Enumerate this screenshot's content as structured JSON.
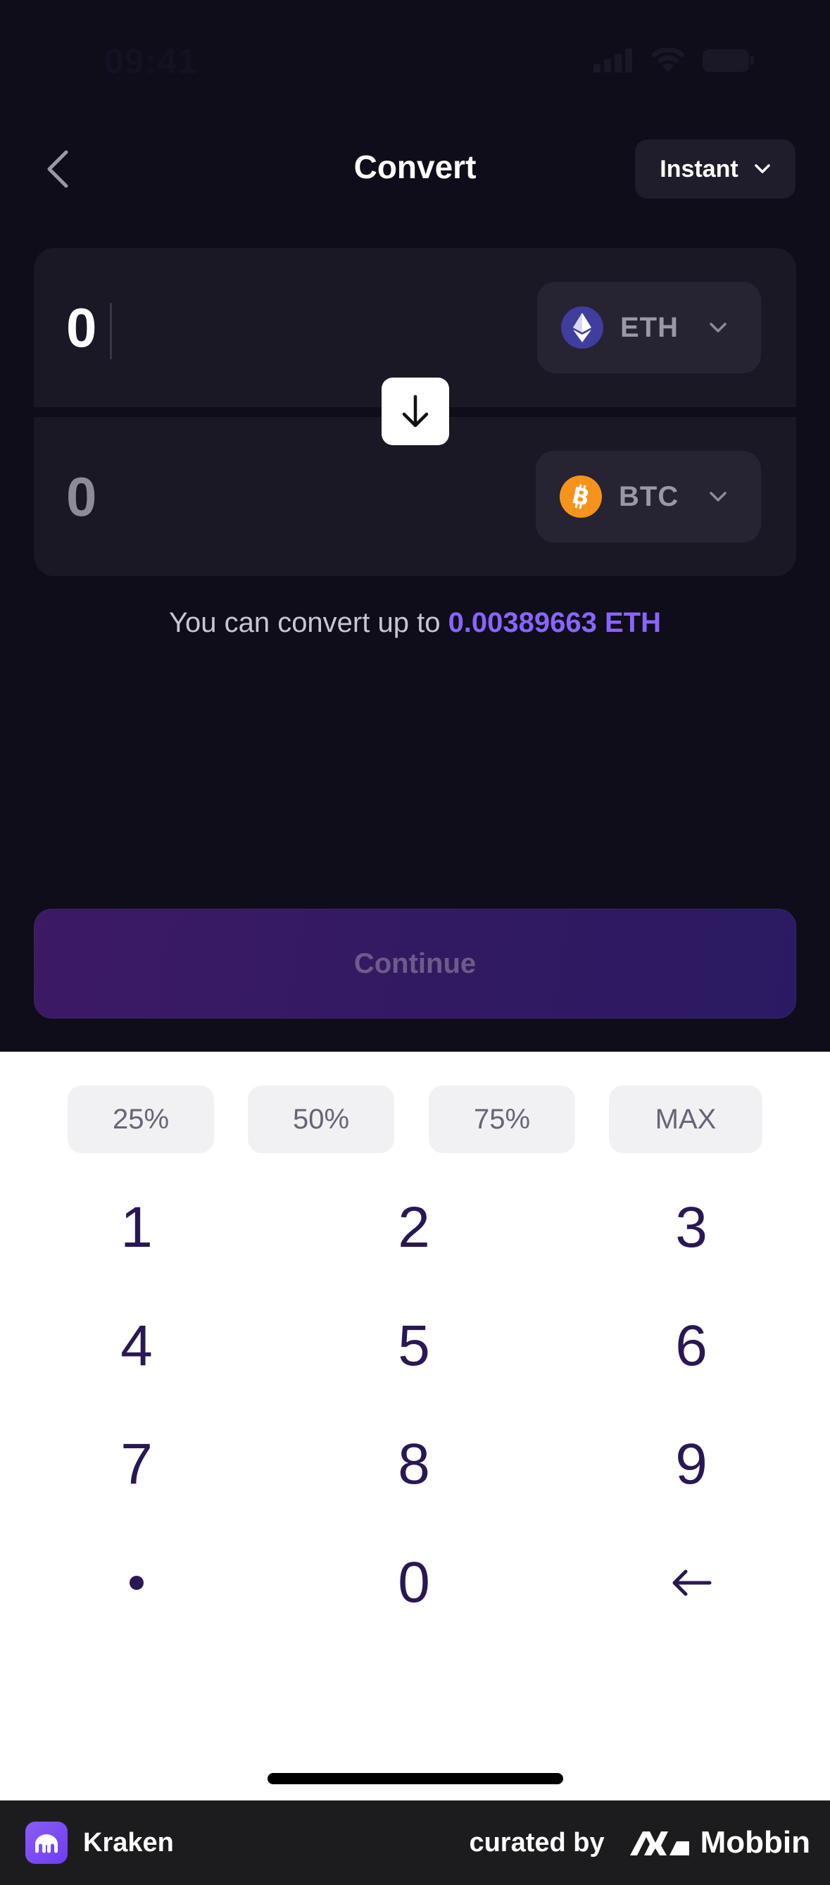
{
  "status_bar": {
    "time": "09:41"
  },
  "header": {
    "title": "Convert",
    "mode_label": "Instant"
  },
  "from": {
    "amount": "0",
    "asset": "ETH",
    "asset_color": "#3f3d9e"
  },
  "to": {
    "amount": "0",
    "asset": "BTC",
    "asset_color": "#f7931a"
  },
  "hint": {
    "prefix": "You can convert up to ",
    "max_amount": "0.00389663 ETH"
  },
  "continue_label": "Continue",
  "percent_buttons": [
    "25%",
    "50%",
    "75%",
    "MAX"
  ],
  "keys": [
    "1",
    "2",
    "3",
    "4",
    "5",
    "6",
    "7",
    "8",
    "9",
    "•",
    "0",
    "←"
  ],
  "footer": {
    "app_name": "Kraken",
    "curated_by": "curated by",
    "brand": "Mobbin"
  },
  "colors": {
    "accent": "#8a64ff",
    "key_text": "#2a1754",
    "background": "#0f0d19"
  }
}
